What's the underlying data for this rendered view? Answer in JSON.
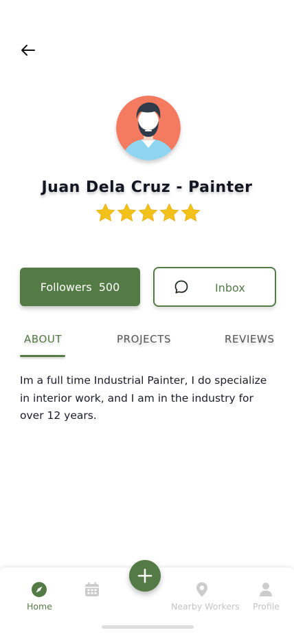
{
  "header": {
    "back_icon": "arrow-left-icon"
  },
  "profile": {
    "avatar_icon": "bearded-man-avatar",
    "name": "Juan Dela Cruz - Painter",
    "rating": 5,
    "rating_max": 5,
    "star_color": "#f2c21a"
  },
  "actions": {
    "followers_label": "Followers",
    "followers_count": "500",
    "inbox_label": "Inbox",
    "inbox_icon": "chat-bubble-icon"
  },
  "tabs": [
    {
      "label": "ABOUT",
      "active": true
    },
    {
      "label": "PROJECTS",
      "active": false
    },
    {
      "label": "REVIEWS",
      "active": false
    }
  ],
  "about_text": "Im a full time Industrial Painter, I do specialize in interior work, and I am in the industry for over 12 years.",
  "bottom_nav": {
    "items": [
      {
        "label": "Home",
        "icon": "compass-icon",
        "active": true
      },
      {
        "label": "",
        "icon": "calendar-icon",
        "active": false
      },
      {
        "label": "Nearby Workers",
        "icon": "location-pin-icon",
        "active": false
      },
      {
        "label": "Profile",
        "icon": "person-icon",
        "active": false
      }
    ],
    "fab_icon": "plus-icon"
  },
  "colors": {
    "accent": "#547a45",
    "inactive_nav": "#cccccc",
    "avatar_bg": "#f47a60"
  }
}
